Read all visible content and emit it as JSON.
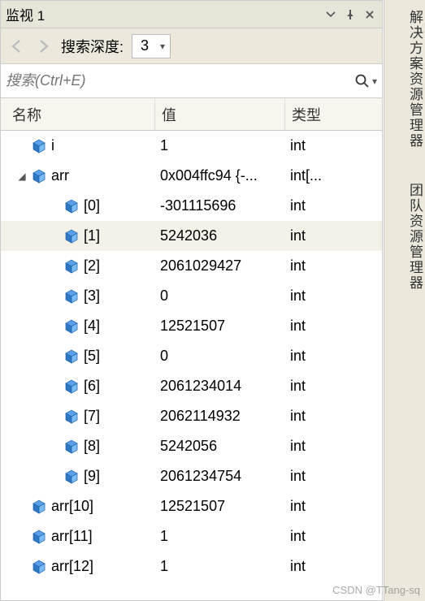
{
  "titlebar": {
    "title": "监视 1"
  },
  "toolbar": {
    "depth_label": "搜索深度:",
    "depth_value": "3"
  },
  "search": {
    "placeholder": "搜索(Ctrl+E)"
  },
  "columns": {
    "name": "名称",
    "value": "值",
    "type": "类型"
  },
  "rows": [
    {
      "indent": 1,
      "expander": "",
      "name": "i",
      "value": "1",
      "type": "int"
    },
    {
      "indent": 1,
      "expander": "▾",
      "name": "arr",
      "value": "0x004ffc94 {-...",
      "type": "int[..."
    },
    {
      "indent": 2,
      "expander": "",
      "name": "[0]",
      "value": "-301115696",
      "type": "int"
    },
    {
      "indent": 2,
      "expander": "",
      "name": "[1]",
      "value": "5242036",
      "type": "int",
      "highlight": true
    },
    {
      "indent": 2,
      "expander": "",
      "name": "[2]",
      "value": "2061029427",
      "type": "int"
    },
    {
      "indent": 2,
      "expander": "",
      "name": "[3]",
      "value": "0",
      "type": "int"
    },
    {
      "indent": 2,
      "expander": "",
      "name": "[4]",
      "value": "12521507",
      "type": "int"
    },
    {
      "indent": 2,
      "expander": "",
      "name": "[5]",
      "value": "0",
      "type": "int"
    },
    {
      "indent": 2,
      "expander": "",
      "name": "[6]",
      "value": "2061234014",
      "type": "int"
    },
    {
      "indent": 2,
      "expander": "",
      "name": "[7]",
      "value": "2062114932",
      "type": "int"
    },
    {
      "indent": 2,
      "expander": "",
      "name": "[8]",
      "value": "5242056",
      "type": "int"
    },
    {
      "indent": 2,
      "expander": "",
      "name": "[9]",
      "value": "2061234754",
      "type": "int"
    },
    {
      "indent": 1,
      "expander": "",
      "name": "arr[10]",
      "value": "12521507",
      "type": "int"
    },
    {
      "indent": 1,
      "expander": "",
      "name": "arr[11]",
      "value": "1",
      "type": "int"
    },
    {
      "indent": 1,
      "expander": "",
      "name": "arr[12]",
      "value": "1",
      "type": "int"
    }
  ],
  "sidebar_tabs": [
    {
      "label": "解决方案资源管理器"
    },
    {
      "label": "团队资源管理器"
    }
  ],
  "watermark": "CSDN @TTang-sq"
}
